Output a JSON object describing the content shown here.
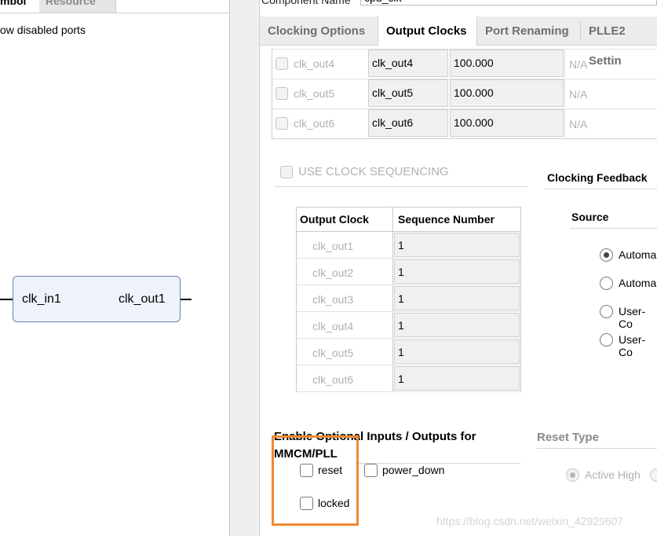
{
  "left_panel": {
    "tabs": [
      "mbol",
      "Resource"
    ],
    "show_disabled": "ow disabled ports",
    "block": {
      "input": "clk_in1",
      "output": "clk_out1"
    }
  },
  "component": {
    "label": "Component Name",
    "value": "cpu_clk"
  },
  "tabs": [
    "Clocking Options",
    "Output Clocks",
    "Port Renaming",
    "PLLE2 Settin"
  ],
  "active_tab": "Output Clocks",
  "output_rows": [
    {
      "name": "clk_out4",
      "port": "clk_out4",
      "freq": "100.000",
      "actual": "N/A"
    },
    {
      "name": "clk_out5",
      "port": "clk_out5",
      "freq": "100.000",
      "actual": "N/A"
    },
    {
      "name": "clk_out6",
      "port": "clk_out6",
      "freq": "100.000",
      "actual": "N/A"
    }
  ],
  "use_clock_sequencing": "USE CLOCK SEQUENCING",
  "sequence_table": {
    "headers": [
      "Output Clock",
      "Sequence Number"
    ],
    "rows": [
      {
        "clock": "clk_out1",
        "seq": "1"
      },
      {
        "clock": "clk_out2",
        "seq": "1"
      },
      {
        "clock": "clk_out3",
        "seq": "1"
      },
      {
        "clock": "clk_out4",
        "seq": "1"
      },
      {
        "clock": "clk_out5",
        "seq": "1"
      },
      {
        "clock": "clk_out6",
        "seq": "1"
      }
    ]
  },
  "feedback": {
    "title": "Clocking Feedback",
    "source_label": "Source",
    "options": [
      "Automa",
      "Automa",
      "User-Co",
      "User-Co"
    ],
    "selected_index": 0
  },
  "optional": {
    "title_line1": "Enable Optional Inputs / Outputs for",
    "title_line2": "MMCM/PLL",
    "reset": "reset",
    "power_down": "power_down",
    "locked": "locked"
  },
  "reset_type": {
    "label": "Reset Type",
    "active_high": "Active High"
  },
  "watermark": "https://blog.csdn.net/weixin_42929607",
  "colors": {
    "highlight": "#f08a32",
    "panel_bg": "#ffffff",
    "tab_bg": "#ececec"
  }
}
